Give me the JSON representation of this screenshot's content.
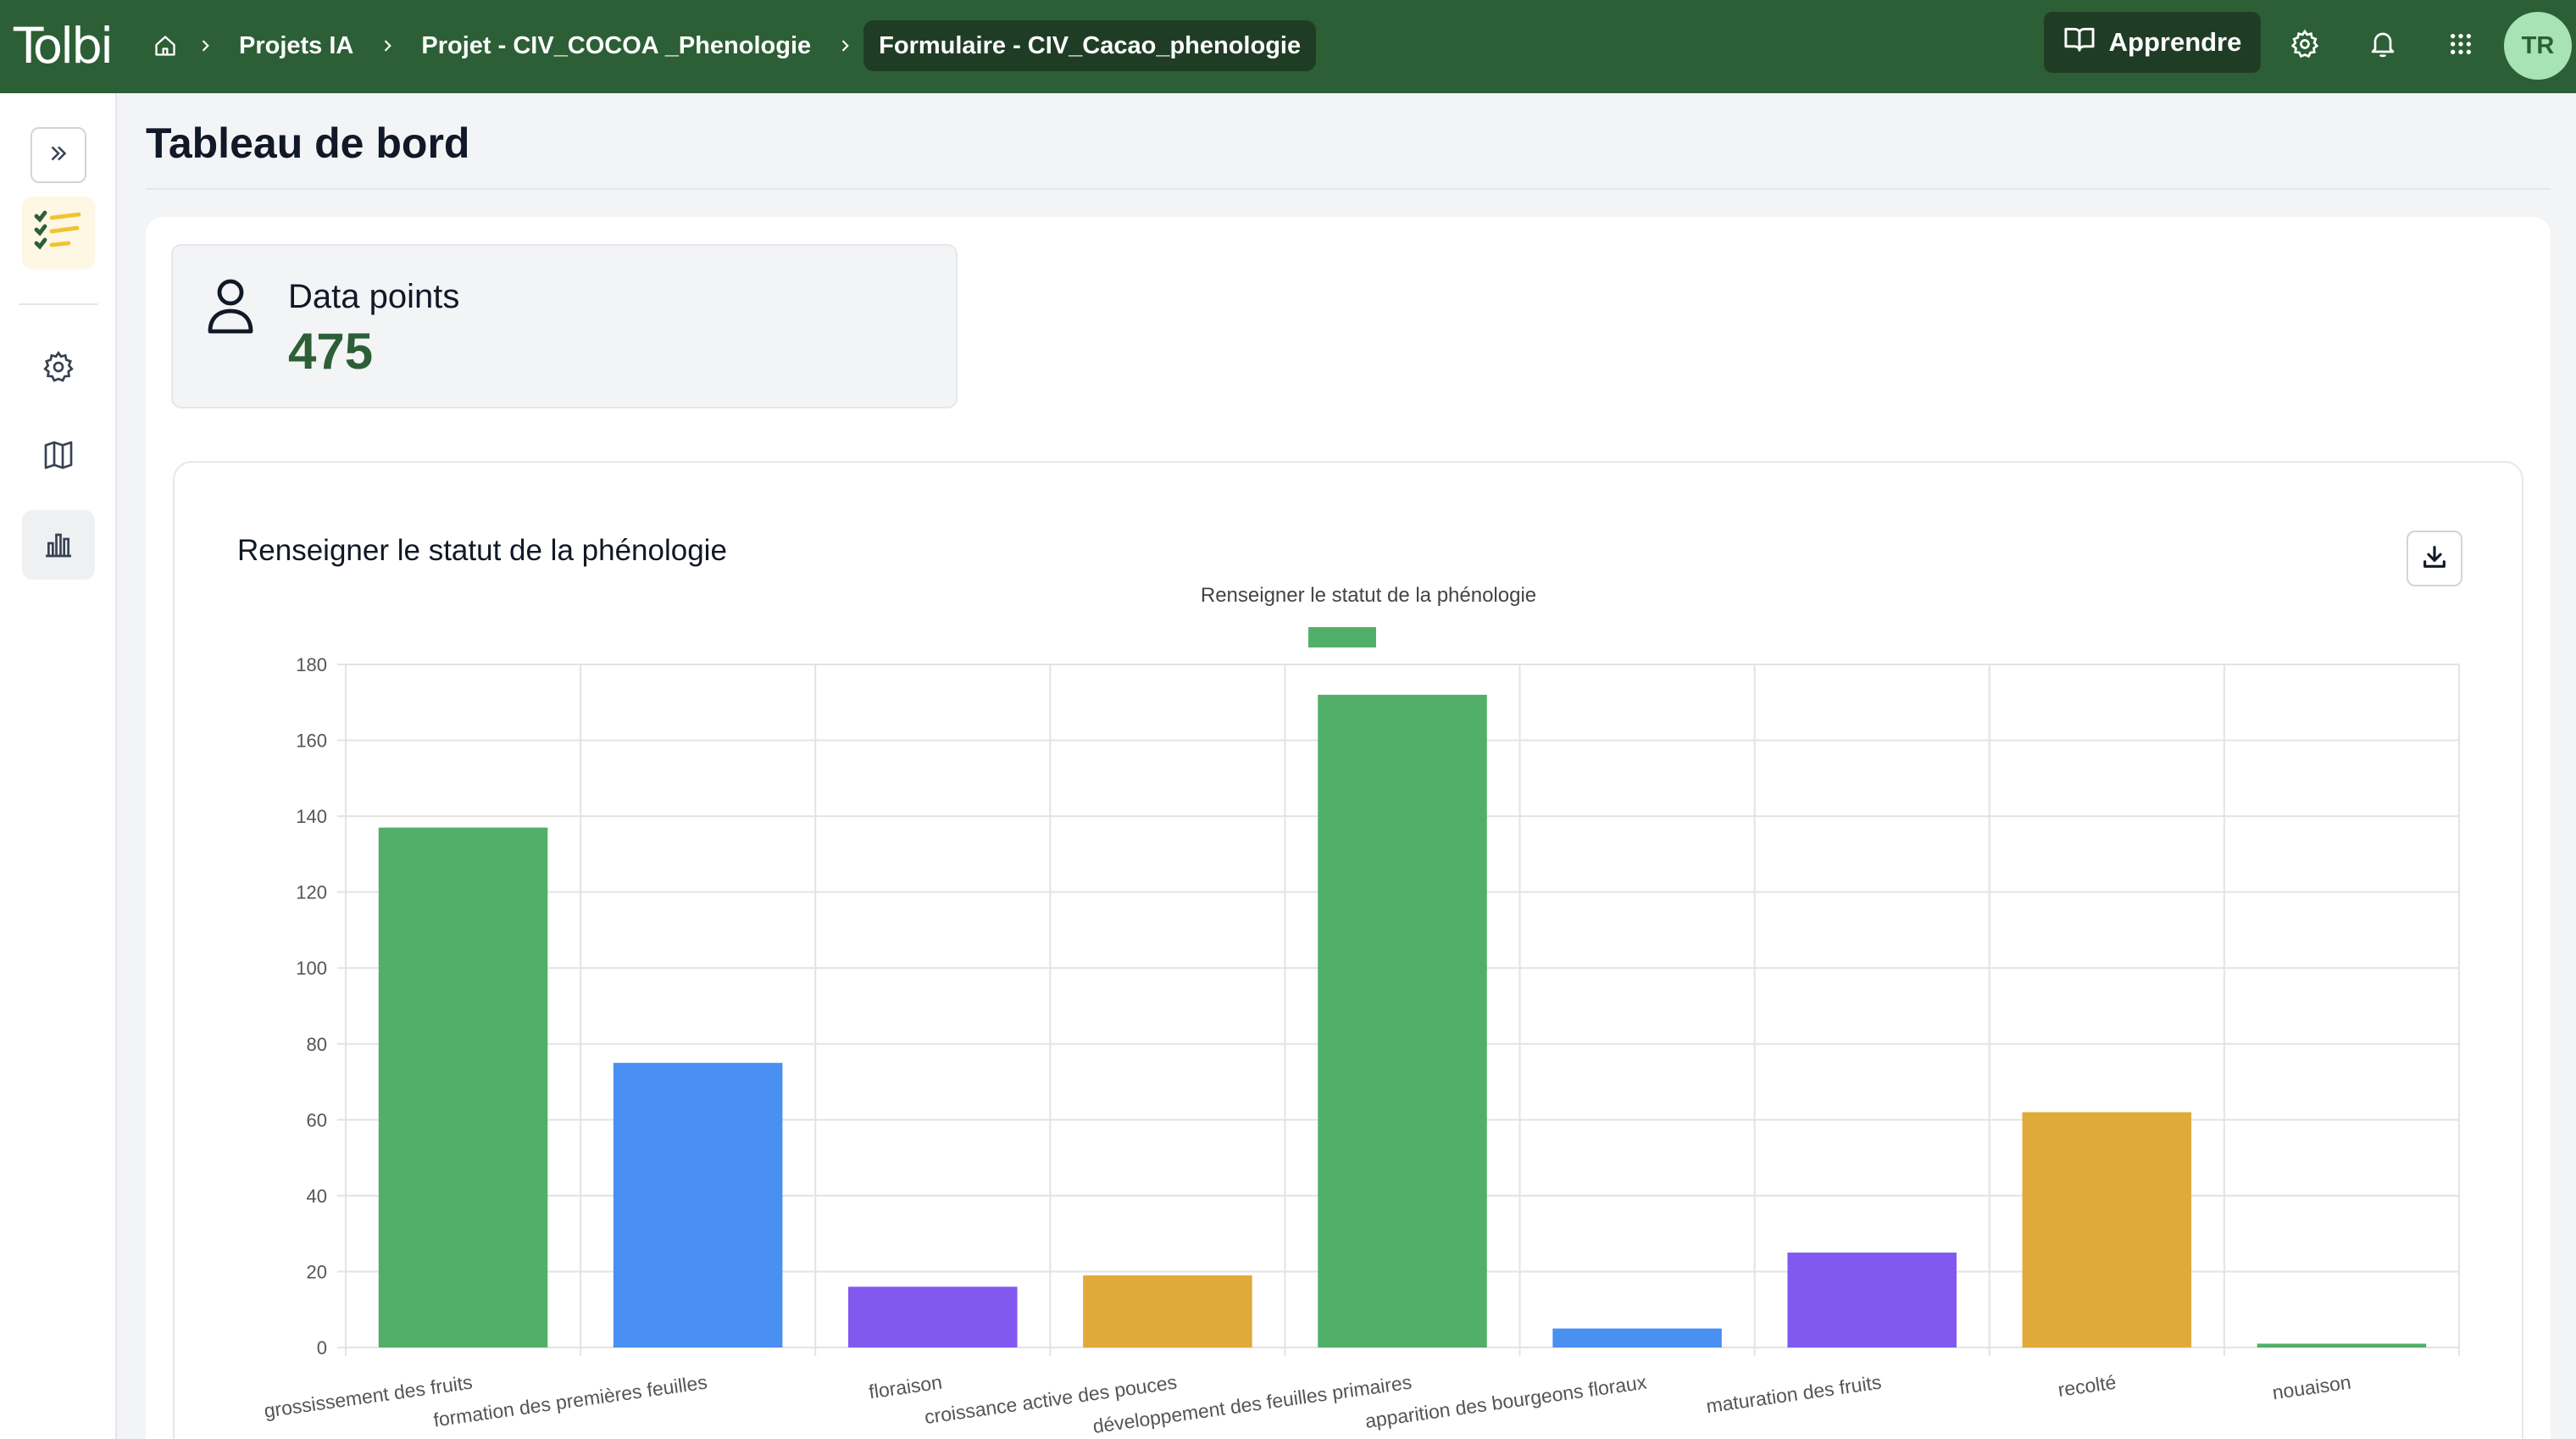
{
  "app": {
    "logo_text": "Tolbi"
  },
  "breadcrumb": {
    "items": [
      {
        "label": "Projets IA"
      },
      {
        "label": "Projet - CIV_COCOA _Phenologie"
      },
      {
        "label": "Formulaire - CIV_Cacao_phenologie"
      }
    ]
  },
  "header": {
    "learn_label": "Apprendre",
    "avatar_initials": "TR"
  },
  "icons": {
    "home": "home-icon",
    "chevron": "chevron-right-icon",
    "learn": "book-icon",
    "settings": "gear-icon",
    "notifications": "bell-icon",
    "apps": "grid-icon",
    "expand": "double-chevron-right-icon",
    "app_checklist": "checklist-icon",
    "map": "map-icon",
    "chart": "bar-chart-icon",
    "user": "user-icon",
    "download": "download-icon"
  },
  "colors": {
    "brand": "#2c5f36",
    "brand_dark": "#1f3d25",
    "avatar_bg": "#a7e3b4",
    "green": "#52af69",
    "blue": "#4a8ff2",
    "purple": "#8158f0",
    "yellow": "#e0aa3a"
  },
  "page": {
    "title": "Tableau de bord"
  },
  "kpi": {
    "label": "Data points",
    "value": "475"
  },
  "chart_card": {
    "title": "Renseigner le statut de la phénologie"
  },
  "chart_data": {
    "type": "bar",
    "title": "Renseigner le statut de la phénologie",
    "legend": [
      {
        "name": "Renseigner le statut de la phénologie",
        "color": "#52af69"
      }
    ],
    "legend_position": "top",
    "categories": [
      "grossissement des fruits",
      "formation des premières  feuilles",
      "floraison",
      "croissance active des pouces",
      "développement des feuilles primaires",
      "apparition des bourgeons floraux",
      "maturation des fruits",
      "recolté",
      "nouaison"
    ],
    "values": [
      137,
      75,
      16,
      19,
      172,
      5,
      25,
      62,
      1
    ],
    "bar_colors": [
      "#52af69",
      "#4a8ff2",
      "#8158f0",
      "#e0aa3a",
      "#52af69",
      "#4a8ff2",
      "#8158f0",
      "#e0aa3a",
      "#52af69"
    ],
    "ylim": [
      0,
      180
    ],
    "yticks": [
      0,
      20,
      40,
      60,
      80,
      100,
      120,
      140,
      160,
      180
    ],
    "grid": true,
    "xlabel": "",
    "ylabel": ""
  }
}
